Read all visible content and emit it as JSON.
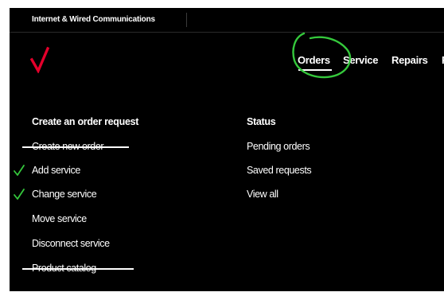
{
  "topbar": {
    "title": "Internet & Wired Communications"
  },
  "logo": {
    "icon": "checkmark-logo-icon",
    "color": "#e4002b"
  },
  "nav": {
    "items": [
      {
        "label": "Orders",
        "selected": true
      },
      {
        "label": "Service"
      },
      {
        "label": "Repairs"
      },
      {
        "label": "P"
      }
    ],
    "annotation": {
      "icon": "hand-drawn-circle-icon",
      "color": "#35c83c"
    }
  },
  "orders_column": {
    "heading": "Create an order request",
    "items": [
      {
        "label": "Create new order",
        "annotation": "strikethrough"
      },
      {
        "label": "Add service",
        "annotation": "checkmark"
      },
      {
        "label": "Change service",
        "annotation": "checkmark"
      },
      {
        "label": "Move service"
      },
      {
        "label": "Disconnect service"
      },
      {
        "label": "Product catalog",
        "annotation": "strikethrough"
      }
    ]
  },
  "status_column": {
    "heading": "Status",
    "items": [
      {
        "label": "Pending orders"
      },
      {
        "label": "Saved requests"
      },
      {
        "label": "View all"
      }
    ]
  },
  "colors": {
    "background": "#000000",
    "text": "#ffffff",
    "annotation_green": "#35c83c",
    "brand_red": "#e4002b"
  }
}
